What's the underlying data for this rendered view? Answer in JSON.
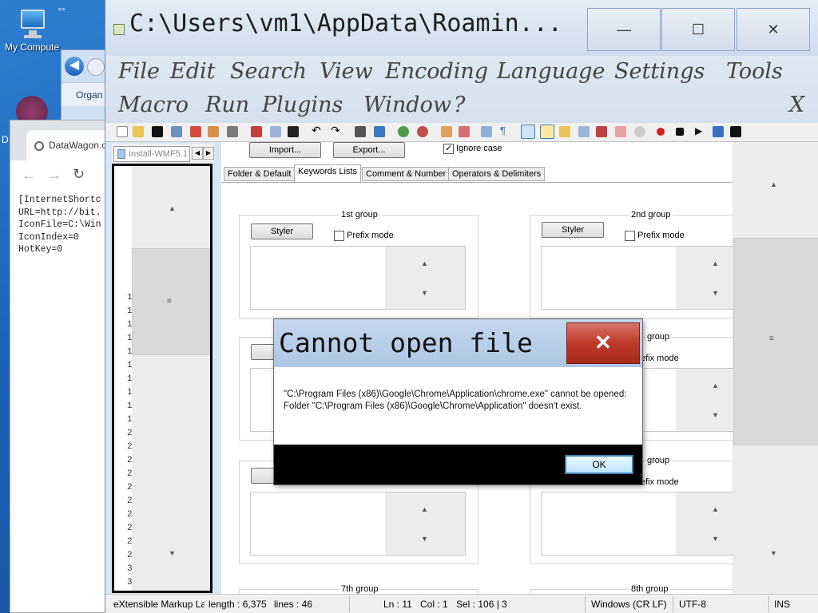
{
  "desktop": {
    "icon_label": "My Compute",
    "side_label": "D",
    "explorer_label": "Organ"
  },
  "browser": {
    "tab_title": "DataWagon.co",
    "content": "[InternetShortc\nURL=http://bit.\nIconFile=C:\\Win\nIconIndex=0\nHotKey=0"
  },
  "npp": {
    "title": "C:\\Users\\vm1\\AppData\\Roamin...",
    "window_buttons": {
      "minimize": "—",
      "maximize": "☐",
      "close": "✕"
    },
    "menu_row1": [
      "File",
      "Edit",
      "Search",
      "View",
      "Encoding",
      "Language",
      "Settings",
      "Tools"
    ],
    "menu_row2": [
      "Macro",
      "Run",
      "Plugins",
      "Window",
      "?"
    ],
    "menu_close": "X",
    "doc_tab": "Install-WMF5.1",
    "line_numbers": [
      "1",
      "1",
      "1",
      "1",
      "1",
      "1",
      "1",
      "1",
      "1",
      "1",
      "2",
      "2",
      "2",
      "2",
      "2",
      "2",
      "2",
      "2",
      "2",
      "2",
      "3",
      "3"
    ],
    "styler": {
      "import_label": "Import...",
      "export_label": "Export...",
      "ignore_case_label": "Ignore case",
      "tabs": [
        "Folder & Default",
        "Keywords Lists",
        "Comment & Number",
        "Operators & Delimiters"
      ],
      "styler_label": "Styler",
      "prefix_mode_label": "Prefix mode",
      "group_1st": "1st group",
      "group_2nd": "2nd group",
      "group_4th_partial": "group",
      "group_6th_partial": "group",
      "group_7th": "7th group",
      "group_8th": "8th group",
      "prefix_partial": "efix mode"
    },
    "status": {
      "language": "eXtensible Markup La",
      "length": "length : 6,375",
      "lines": "lines : 46",
      "ln": "Ln : 11",
      "col": "Col : 1",
      "sel": "Sel : 106 | 3",
      "eol": "Windows (CR LF)",
      "encoding": "UTF-8",
      "mode": "INS"
    }
  },
  "dialog": {
    "title": "Cannot open file",
    "close": "✕",
    "message_line1": "\"C:\\Program Files (x86)\\Google\\Chrome\\Application\\chrome.exe\" cannot be opened:",
    "message_line2": "Folder \"C:\\Program Files (x86)\\Google\\Chrome\\Application\" doesn't exist.",
    "ok_label": "OK"
  },
  "colors": {
    "titlebar": "#cfdcee",
    "close_red": "#c0392b",
    "desktop_blue": "#1b63b8"
  }
}
